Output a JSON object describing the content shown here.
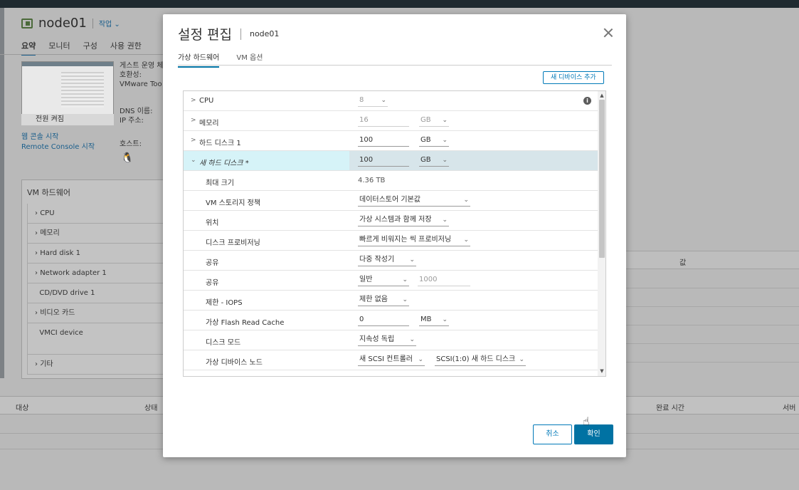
{
  "background": {
    "vm_name": "node01",
    "actions_label": "작업 ⌄",
    "tabs": [
      "요약",
      "모니터",
      "구성",
      "사용 권한"
    ],
    "meta_lines": [
      "게스트 운영 체",
      "호환성:",
      "VMware Too"
    ],
    "meta_lines2": [
      "DNS 이름:",
      "IP 주소:"
    ],
    "host_label": "호스트:",
    "console_button": "전원 켜짐",
    "links": [
      "웹 콘솔 시작",
      "Remote Console 시작"
    ],
    "hw_title": "VM 하드웨어",
    "hw_items": [
      "CPU",
      "메모리",
      "Hard disk 1",
      "Network adapter 1",
      "CD/DVD drive 1",
      "비디오 카드",
      "VMCI device",
      "",
      "기타"
    ],
    "right_header": "값",
    "tasks_headers": [
      "대상",
      "상태",
      "완료 시간",
      "서버"
    ]
  },
  "dialog": {
    "title": "설정 편집",
    "subtitle": "node01",
    "tabs": [
      {
        "label": "가상 하드웨어",
        "active": true
      },
      {
        "label": "VM 옵션",
        "active": false
      }
    ],
    "add_device": "새 디바이스 추가",
    "rows": [
      {
        "label": "CPU",
        "expand": ">",
        "field1": "8"
      },
      {
        "label": "메모리",
        "expand": ">",
        "field1": "16",
        "unit": "GB"
      },
      {
        "label": "하드 디스크 1",
        "expand": ">",
        "field1": "100",
        "unit": "GB"
      },
      {
        "label": "새 하드 디스크 *",
        "expand": "⌄",
        "field1": "100",
        "unit": "GB"
      },
      {
        "label": "최대 크기",
        "value": "4.36 TB"
      },
      {
        "label": "VM 스토리지 정책",
        "field1": "데이터스토어 기본값"
      },
      {
        "label": "위치",
        "field1": "가상 시스템과 함께 저장"
      },
      {
        "label": "디스크 프로비저닝",
        "field1": "빠르게 비워지는 씩 프로비저닝"
      },
      {
        "label": "공유",
        "field1": "다중 작성기"
      },
      {
        "label": "공유",
        "field1": "일반",
        "field2": "1000"
      },
      {
        "label": "제한 - IOPS",
        "field1": "제한 없음"
      },
      {
        "label": "가상 Flash Read Cache",
        "field1": "0",
        "unit": "MB"
      },
      {
        "label": "디스크 모드",
        "field1": "지속성 독립"
      },
      {
        "label": "가상 디바이스 노드",
        "field1": "새 SCSI 컨트롤러",
        "field2": "SCSI(1:0) 새 하드 디스크"
      }
    ],
    "info_icon": "info-icon",
    "cancel": "취소",
    "ok": "확인"
  },
  "colors": {
    "accent": "#0072a3",
    "highlight_row": "#d7e5ea",
    "highlight_label": "#d6f3f8"
  }
}
